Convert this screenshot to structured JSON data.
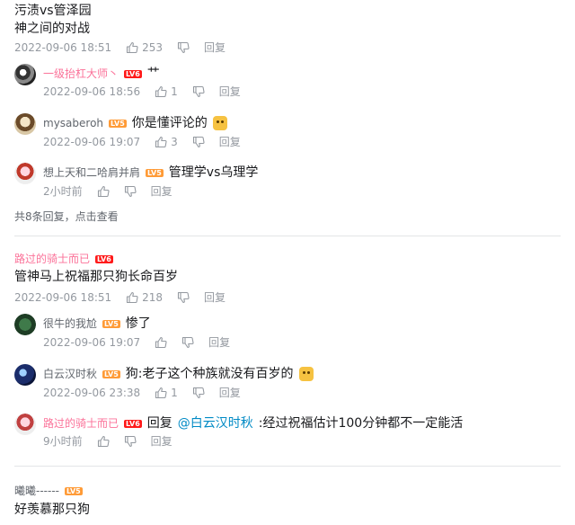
{
  "thread1": {
    "text1": "污渍vs管泽园",
    "text2": "神之间的对战",
    "time": "2022-09-06 18:51",
    "likes": "253",
    "reply_label": "回复",
    "replies": [
      {
        "user": "一级抬杠大师丶",
        "level": "LV6",
        "content": "艹",
        "time": "2022-09-06 18:56",
        "likes": "1",
        "reply_label": "回复"
      },
      {
        "user": "mysaberoh",
        "level": "LV5",
        "content": "你是懂评论的",
        "time": "2022-09-06 19:07",
        "likes": "3",
        "reply_label": "回复"
      },
      {
        "user": "想上天和二哈肩并肩",
        "level": "LV5",
        "content": "管理学vs乌理学",
        "time": "2小时前",
        "reply_label": "回复"
      }
    ],
    "more_text": "共8条回复，点击查看"
  },
  "thread2": {
    "user": "路过的骑士而已",
    "level": "LV6",
    "text": "管神马上祝福那只狗长命百岁",
    "time": "2022-09-06 18:51",
    "likes": "218",
    "reply_label": "回复",
    "replies": [
      {
        "user": "很牛的我尬",
        "level": "LV5",
        "content": "惨了",
        "time": "2022-09-06 19:07",
        "reply_label": "回复"
      },
      {
        "user": "白云汉时秋",
        "level": "LV5",
        "content": "狗:老子这个种族就没有百岁的",
        "time": "2022-09-06 23:38",
        "likes": "1",
        "reply_label": "回复"
      },
      {
        "user": "路过的骑士而已",
        "level": "LV6",
        "content_prefix": "回复",
        "mention": "@白云汉时秋",
        "content": ":经过祝福估计100分钟都不一定能活",
        "time": "9小时前",
        "reply_label": "回复"
      }
    ]
  },
  "thread3": {
    "user": "曦曦------",
    "level": "LV5",
    "text": "好羡慕那只狗"
  }
}
